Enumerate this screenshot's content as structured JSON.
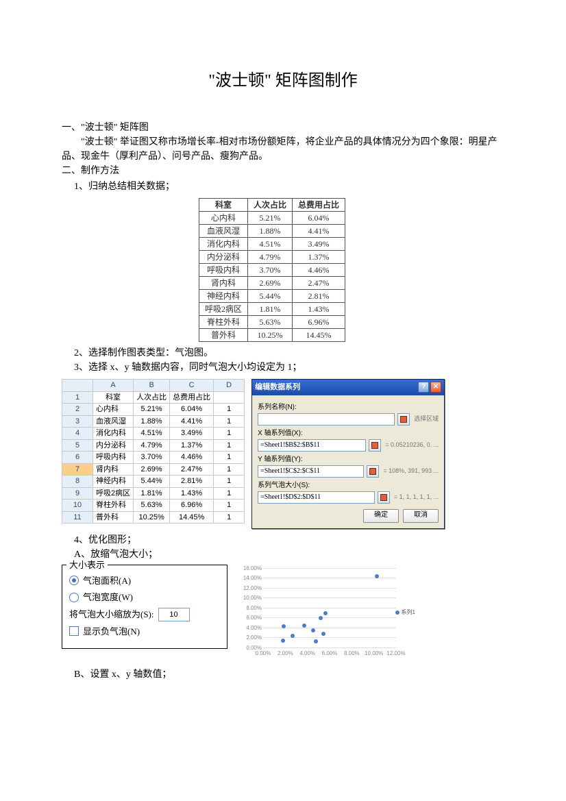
{
  "title": "\"波士顿\" 矩阵图制作",
  "section1": {
    "heading": "一、\"波士顿\" 矩阵图",
    "body": "\"波士顿\" 举证图又称市场增长率-相对市场份额矩阵，将企业产品的具体情况分为四个象限：明星产品、现金牛（厚利产品）、问号产品、瘦狗产品。"
  },
  "section2_heading": "二、制作方法",
  "summary_table": {
    "headers": [
      "科室",
      "人次占比",
      "总费用占比"
    ],
    "rows": [
      [
        "心内科",
        "5.21%",
        "6.04%"
      ],
      [
        "血液风湿",
        "1.88%",
        "4.41%"
      ],
      [
        "消化内科",
        "4.51%",
        "3.49%"
      ],
      [
        "内分泌科",
        "4.79%",
        "1.37%"
      ],
      [
        "呼吸内科",
        "3.70%",
        "4.46%"
      ],
      [
        "肾内科",
        "2.69%",
        "2.47%"
      ],
      [
        "神经内科",
        "5.44%",
        "2.81%"
      ],
      [
        "呼吸2病区",
        "1.81%",
        "1.43%"
      ],
      [
        "脊柱外科",
        "5.63%",
        "6.96%"
      ],
      [
        "普外科",
        "10.25%",
        "14.45%"
      ]
    ]
  },
  "step1": "1、归纳总结相关数据；",
  "step2": "2、选择制作图表类型：气泡图。",
  "step3": "3、选择 x、y 轴数据内容，同时气泡大小均设定为 1；",
  "excel": {
    "cols": [
      "",
      "A",
      "B",
      "C",
      "D"
    ],
    "header_row": [
      "1",
      "科室",
      "人次占比",
      "总费用占比",
      ""
    ],
    "rows": [
      [
        "2",
        "心内科",
        "5.21%",
        "6.04%",
        "1"
      ],
      [
        "3",
        "血液风湿",
        "1.88%",
        "4.41%",
        "1"
      ],
      [
        "4",
        "消化内科",
        "4.51%",
        "3.49%",
        "1"
      ],
      [
        "5",
        "内分泌科",
        "4.79%",
        "1.37%",
        "1"
      ],
      [
        "6",
        "呼吸内科",
        "3.70%",
        "4.46%",
        "1"
      ],
      [
        "7",
        "肾内科",
        "2.69%",
        "2.47%",
        "1"
      ],
      [
        "8",
        "神经内科",
        "5.44%",
        "2.81%",
        "1"
      ],
      [
        "9",
        "呼吸2病区",
        "1.81%",
        "1.43%",
        "1"
      ],
      [
        "10",
        "脊柱外科",
        "5.63%",
        "6.96%",
        "1"
      ],
      [
        "11",
        "普外科",
        "10.25%",
        "14.45%",
        "1"
      ]
    ],
    "selected_row_index": 5
  },
  "dialog": {
    "title": "编辑数据系列",
    "name_label": "系列名称(N):",
    "select_hint": "选择区域",
    "x_label": "X 轴系列值(X):",
    "x_val": "=Sheet1!$B$2:$B$11",
    "x_hint": "= 0.05210236, 0. ...",
    "y_label": "Y 轴系列值(Y):",
    "y_val": "=Sheet1!$C$2:$C$11",
    "y_hint": "= 108%, 391, 993 ...",
    "size_label": "系列气泡大小(S):",
    "size_val": "=Sheet1!$D$2:$D$11",
    "size_hint": "= 1, 1, 1, 1, 1, ...",
    "ok": "确定",
    "cancel": "取消"
  },
  "step4": "4、优化图形；",
  "step4a": "A、放缩气泡大小；",
  "size_panel": {
    "title": "大小表示",
    "opt_area": "气泡面积(A)",
    "opt_width": "气泡宽度(W)",
    "scale_label_pre": "将气泡大小缩放为(S):",
    "scale_value": "10",
    "show_neg": "显示负气泡(N)"
  },
  "mini_chart_legend": "系列1",
  "step4b": "B、设置 x、y 轴数值；",
  "chart_data": {
    "type": "scatter",
    "xlabel": "",
    "ylabel": "",
    "xlim": [
      0,
      12
    ],
    "ylim": [
      0,
      16
    ],
    "x_ticks": [
      "0.00%",
      "2.00%",
      "4.00%",
      "6.00%",
      "8.00%",
      "10.00%",
      "12.00%"
    ],
    "y_ticks": [
      "0.00%",
      "2.00%",
      "4.00%",
      "6.00%",
      "8.00%",
      "10.00%",
      "12.00%",
      "14.00%",
      "16.00%"
    ],
    "series": [
      {
        "name": "系列1",
        "points": [
          {
            "x": 5.21,
            "y": 6.04
          },
          {
            "x": 1.88,
            "y": 4.41
          },
          {
            "x": 4.51,
            "y": 3.49
          },
          {
            "x": 4.79,
            "y": 1.37
          },
          {
            "x": 3.7,
            "y": 4.46
          },
          {
            "x": 2.69,
            "y": 2.47
          },
          {
            "x": 5.44,
            "y": 2.81
          },
          {
            "x": 1.81,
            "y": 1.43
          },
          {
            "x": 5.63,
            "y": 6.96
          },
          {
            "x": 10.25,
            "y": 14.45
          }
        ]
      }
    ]
  }
}
